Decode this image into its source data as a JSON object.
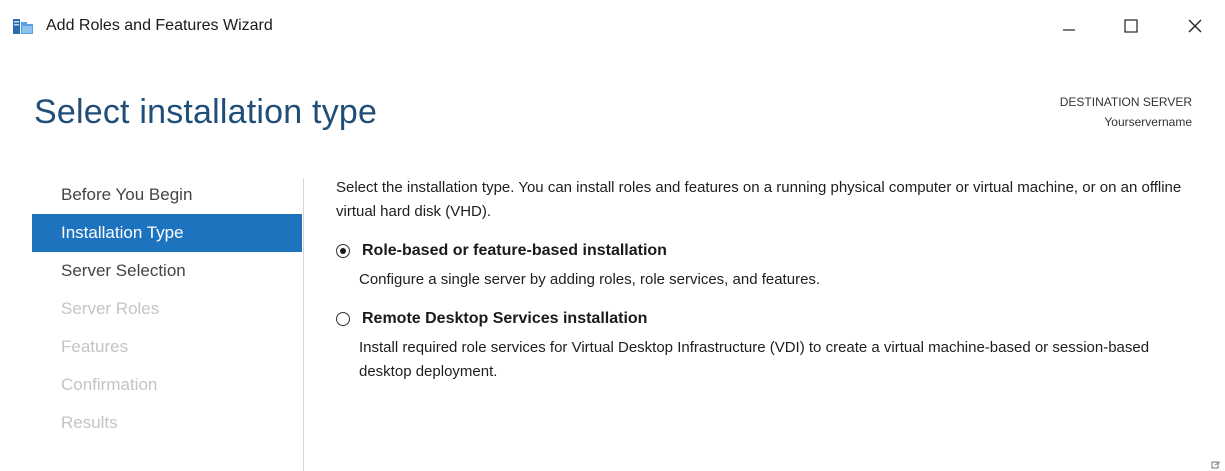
{
  "window": {
    "title": "Add Roles and Features Wizard",
    "icon": "server-manager-icon",
    "controls": [
      "minimize-icon",
      "maximize-icon",
      "close-icon"
    ]
  },
  "header": {
    "page_title": "Select installation type",
    "destination_label": "DESTINATION SERVER",
    "destination_value": "Yourservername"
  },
  "nav": {
    "items": [
      {
        "label": "Before You Begin",
        "state": "normal"
      },
      {
        "label": "Installation Type",
        "state": "active"
      },
      {
        "label": "Server Selection",
        "state": "normal"
      },
      {
        "label": "Server Roles",
        "state": "disabled"
      },
      {
        "label": "Features",
        "state": "disabled"
      },
      {
        "label": "Confirmation",
        "state": "disabled"
      },
      {
        "label": "Results",
        "state": "disabled"
      }
    ]
  },
  "content": {
    "intro": "Select the installation type. You can install roles and features on a running physical computer or virtual machine, or on an offline virtual hard disk (VHD).",
    "options": [
      {
        "label": "Role-based or feature-based installation",
        "description": "Configure a single server by adding roles, role services, and features.",
        "selected": true
      },
      {
        "label": "Remote Desktop Services installation",
        "description": "Install required role services for Virtual Desktop Infrastructure (VDI) to create a virtual machine-based or session-based desktop deployment.",
        "selected": false
      }
    ]
  },
  "colors": {
    "accent": "#1e73be",
    "title": "#1f4e79",
    "disabled_text": "#c4c4c4"
  }
}
